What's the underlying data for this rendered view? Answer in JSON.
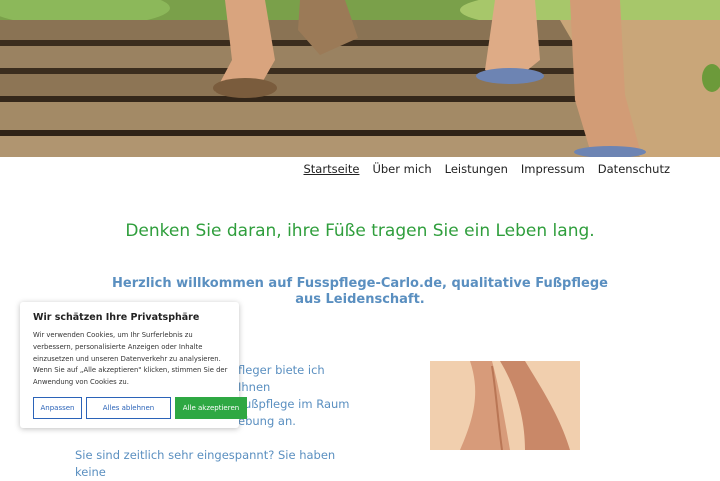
{
  "nav": {
    "items": [
      {
        "label": "Startseite",
        "active": true
      },
      {
        "label": "Über mich"
      },
      {
        "label": "Leistungen"
      },
      {
        "label": "Impressum"
      },
      {
        "label": "Datenschutz"
      }
    ]
  },
  "main": {
    "tagline": "Denken Sie daran, ihre Füße tragen Sie ein Leben lang.",
    "welcome": "Herzlich willkommen auf Fusspflege-Carlo.de, qualitative Fußpflege aus Leidenschaft.",
    "body_lines": [
      "fleger biete ich Ihnen",
      "Fußpflege im Raum",
      "ebung an."
    ],
    "body_p2": "Sie sind zeitlich sehr eingespannt? Sie haben keine"
  },
  "cookie": {
    "title": "Wir schätzen Ihre Privatsphäre",
    "text": "Wir verwenden Cookies, um Ihr Surferlebnis zu verbessern, personalisierte Anzeigen oder Inhalte einzusetzen und unseren Datenverkehr zu analysieren. Wenn Sie auf „Alle akzeptieren\" klicken, stimmen Sie der Anwendung von Cookies zu.",
    "adjust_label": "Anpassen",
    "reject_label": "Alles ablehnen",
    "accept_label": "Alle akzeptieren"
  },
  "colors": {
    "tagline": "#2f9e3c",
    "link_text": "#5a8fc0",
    "accept_button": "#2ea843",
    "outline_button": "#2b63b8"
  }
}
